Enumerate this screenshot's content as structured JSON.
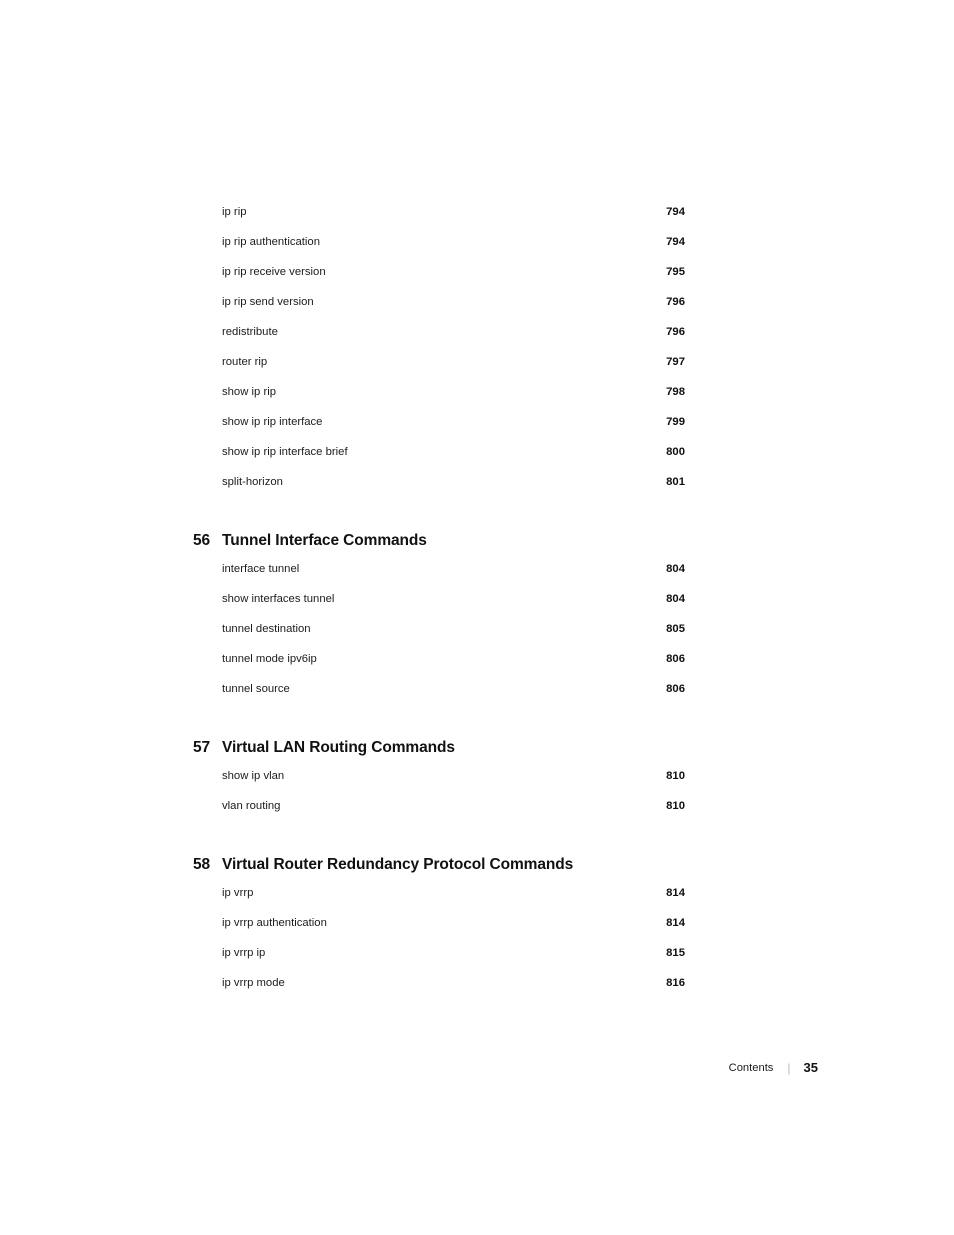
{
  "document": {
    "type": "table-of-contents",
    "footer": {
      "label": "Contents",
      "separator": "|",
      "page_number": "35"
    }
  },
  "toc": {
    "leading_entries": [
      {
        "label": "ip rip",
        "page": "794"
      },
      {
        "label": "ip rip authentication",
        "page": "794"
      },
      {
        "label": "ip rip receive version",
        "page": "795"
      },
      {
        "label": "ip rip send version",
        "page": "796"
      },
      {
        "label": "redistribute",
        "page": "796"
      },
      {
        "label": "router rip",
        "page": "797"
      },
      {
        "label": "show ip rip",
        "page": "798"
      },
      {
        "label": "show ip rip interface",
        "page": "799"
      },
      {
        "label": "show ip rip interface brief",
        "page": "800"
      },
      {
        "label": "split-horizon",
        "page": "801"
      }
    ],
    "chapters": [
      {
        "number": "56",
        "title": "Tunnel Interface Commands",
        "entries": [
          {
            "label": "interface tunnel",
            "page": "804"
          },
          {
            "label": "show interfaces tunnel",
            "page": "804"
          },
          {
            "label": "tunnel destination",
            "page": "805"
          },
          {
            "label": "tunnel mode ipv6ip",
            "page": "806"
          },
          {
            "label": "tunnel source",
            "page": "806"
          }
        ]
      },
      {
        "number": "57",
        "title": "Virtual LAN Routing Commands",
        "entries": [
          {
            "label": "show ip vlan",
            "page": "810"
          },
          {
            "label": "vlan routing",
            "page": "810"
          }
        ]
      },
      {
        "number": "58",
        "title": "Virtual Router Redundancy Protocol Commands",
        "entries": [
          {
            "label": "ip vrrp",
            "page": "814"
          },
          {
            "label": "ip vrrp authentication",
            "page": "814"
          },
          {
            "label": "ip vrrp ip",
            "page": "815"
          },
          {
            "label": "ip vrrp mode",
            "page": "816"
          }
        ]
      }
    ]
  }
}
